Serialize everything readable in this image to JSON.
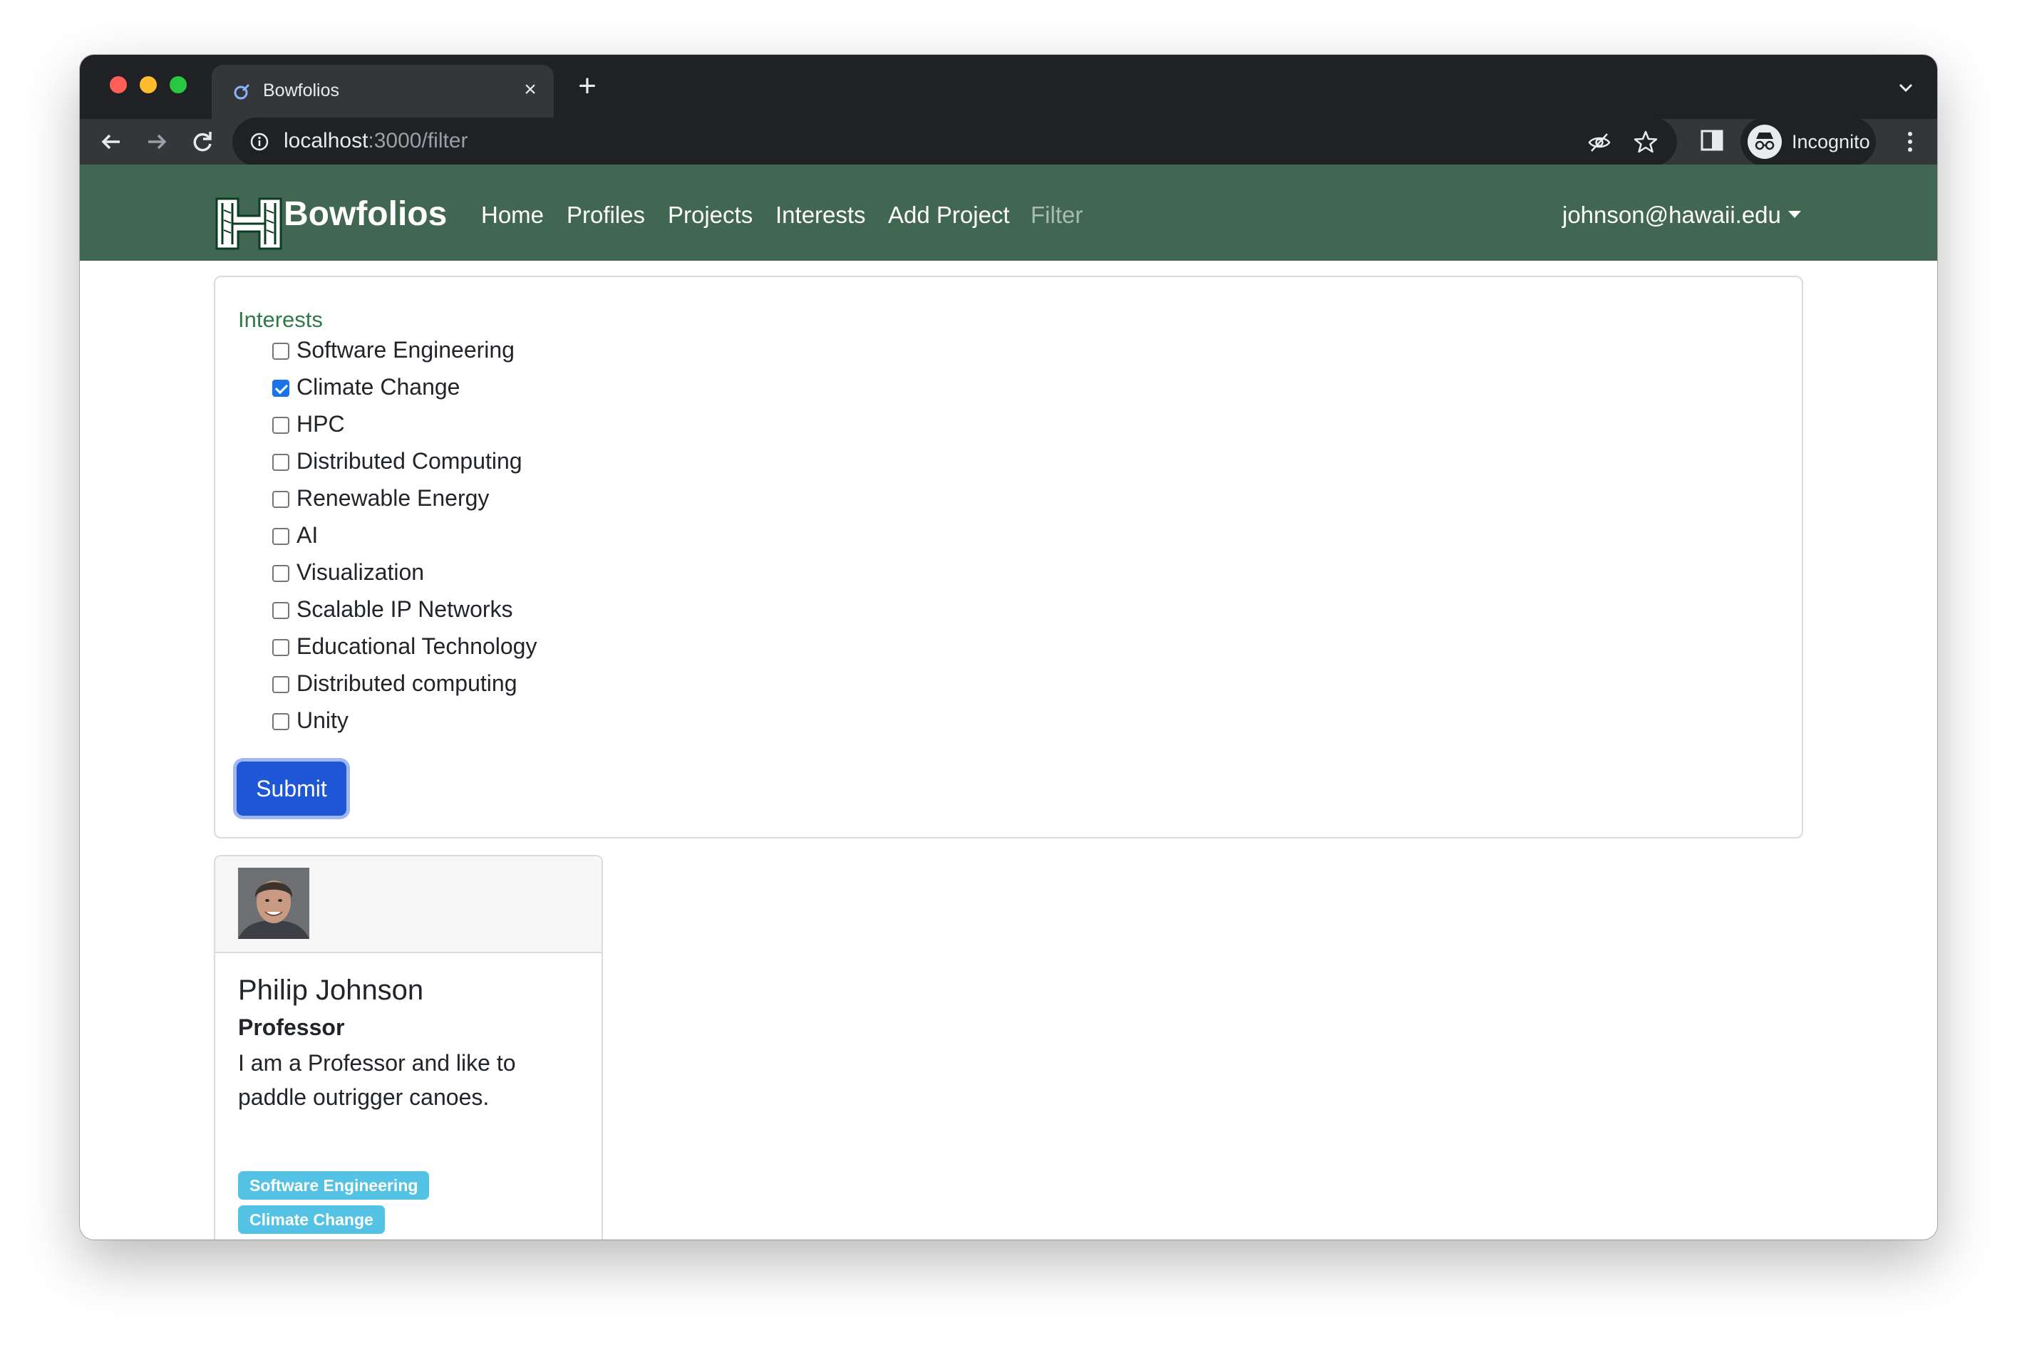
{
  "browser": {
    "tab_title": "Bowfolios",
    "url_host": "localhost",
    "url_path": ":3000/filter",
    "profile_label": "Incognito"
  },
  "site": {
    "brand": "Bowfolios",
    "nav": [
      {
        "label": "Home",
        "active": false
      },
      {
        "label": "Profiles",
        "active": false
      },
      {
        "label": "Projects",
        "active": false
      },
      {
        "label": "Interests",
        "active": false
      },
      {
        "label": "Add Project",
        "active": false
      },
      {
        "label": "Filter",
        "active": true
      }
    ],
    "user": "johnson@hawaii.edu",
    "colors": {
      "navbar": "#416652",
      "accent": "#1e56d6",
      "badge": "#54c2e4"
    }
  },
  "filter": {
    "label": "Interests",
    "options": [
      {
        "label": "Software Engineering",
        "checked": false
      },
      {
        "label": "Climate Change",
        "checked": true
      },
      {
        "label": "HPC",
        "checked": false
      },
      {
        "label": "Distributed Computing",
        "checked": false
      },
      {
        "label": "Renewable Energy",
        "checked": false
      },
      {
        "label": "AI",
        "checked": false
      },
      {
        "label": "Visualization",
        "checked": false
      },
      {
        "label": "Scalable IP Networks",
        "checked": false
      },
      {
        "label": "Educational Technology",
        "checked": false
      },
      {
        "label": "Distributed computing",
        "checked": false
      },
      {
        "label": "Unity",
        "checked": false
      }
    ],
    "submit_label": "Submit"
  },
  "profile": {
    "name": "Philip Johnson",
    "title": "Professor",
    "bio": "I am a Professor and like to paddle outrigger canoes.",
    "interests": [
      "Software Engineering",
      "Climate Change"
    ]
  }
}
